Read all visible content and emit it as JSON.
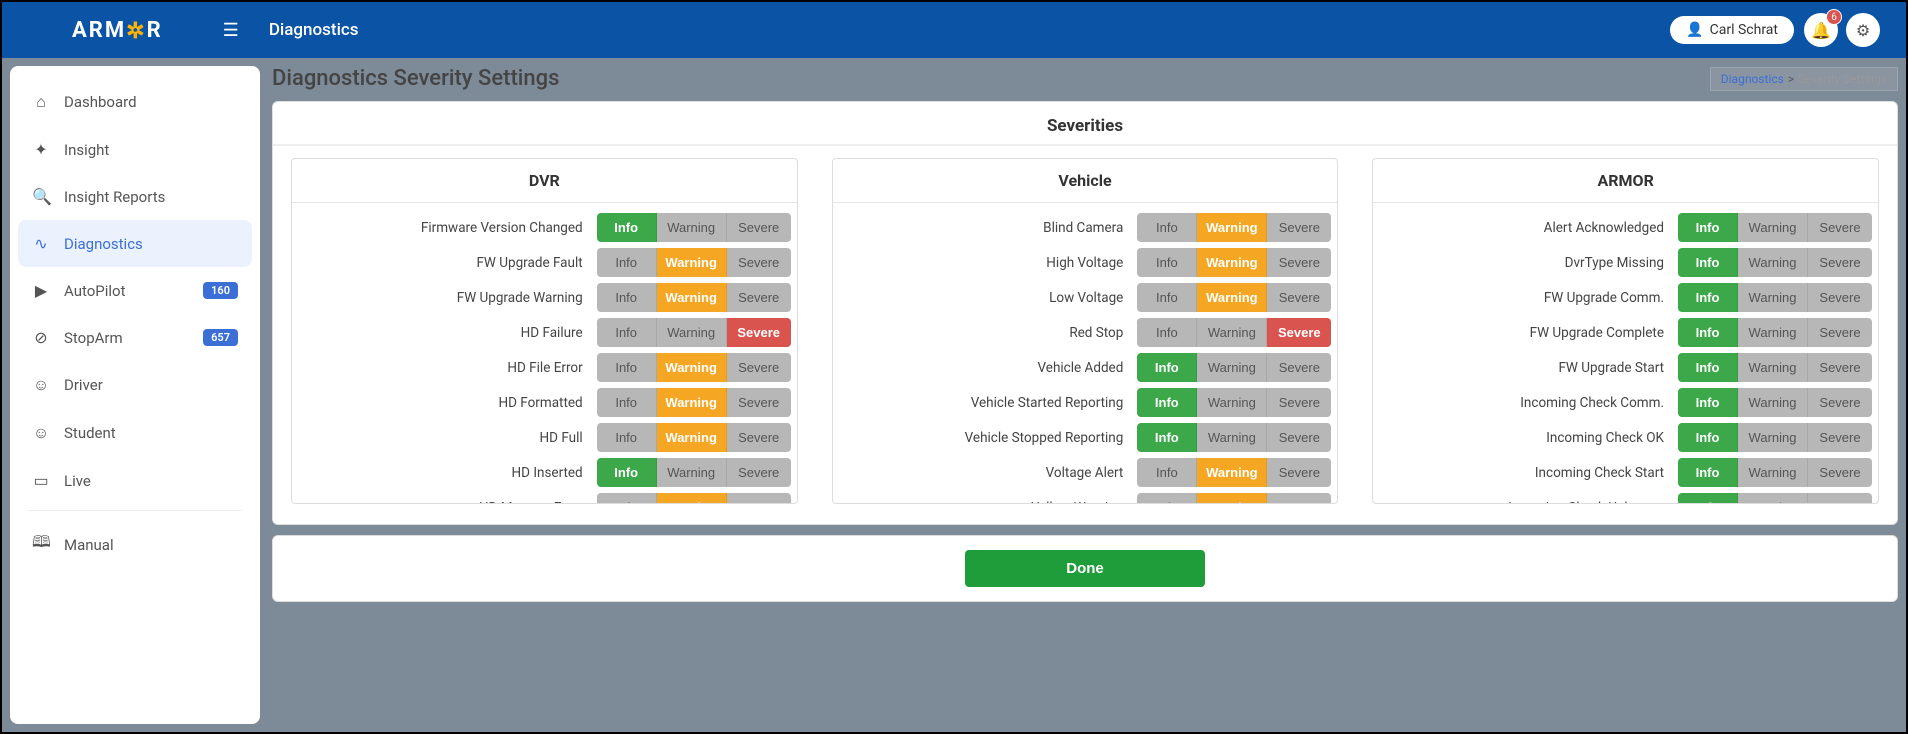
{
  "header": {
    "logo_prefix": "ARM",
    "logo_gear": "✲",
    "logo_suffix": "R",
    "title": "Diagnostics",
    "user_name": "Carl Schrat",
    "notification_count": "6"
  },
  "sidebar": {
    "items": [
      {
        "icon": "⌂",
        "label": "Dashboard",
        "badge": "",
        "active": false
      },
      {
        "icon": "✦",
        "label": "Insight",
        "badge": "",
        "active": false
      },
      {
        "icon": "🔍",
        "label": "Insight Reports",
        "badge": "",
        "active": false
      },
      {
        "icon": "∿",
        "label": "Diagnostics",
        "badge": "",
        "active": true
      },
      {
        "icon": "▶",
        "label": "AutoPilot",
        "badge": "160",
        "active": false
      },
      {
        "icon": "⊘",
        "label": "StopArm",
        "badge": "657",
        "active": false
      },
      {
        "icon": "☺",
        "label": "Driver",
        "badge": "",
        "active": false
      },
      {
        "icon": "☺",
        "label": "Student",
        "badge": "",
        "active": false
      },
      {
        "icon": "▭",
        "label": "Live",
        "badge": "",
        "active": false
      }
    ],
    "manual_label": "Manual",
    "manual_icon": "🕮"
  },
  "page": {
    "title": "Diagnostics Severity Settings",
    "breadcrumb_parent": "Diagnostics",
    "breadcrumb_sep": ">",
    "breadcrumb_current": "Severity Settings"
  },
  "severities": {
    "heading": "Severities",
    "labels": {
      "info": "Info",
      "warning": "Warning",
      "severe": "Severe"
    },
    "groups": [
      {
        "title": "DVR",
        "rows": [
          {
            "label": "Firmware Version Changed",
            "selected": "info"
          },
          {
            "label": "FW Upgrade Fault",
            "selected": "warning"
          },
          {
            "label": "FW Upgrade Warning",
            "selected": "warning"
          },
          {
            "label": "HD Failure",
            "selected": "severe"
          },
          {
            "label": "HD File Error",
            "selected": "warning"
          },
          {
            "label": "HD Formatted",
            "selected": "warning"
          },
          {
            "label": "HD Full",
            "selected": "warning"
          },
          {
            "label": "HD Inserted",
            "selected": "info"
          },
          {
            "label": "HD Memory Error",
            "selected": "warning"
          }
        ]
      },
      {
        "title": "Vehicle",
        "rows": [
          {
            "label": "Blind Camera",
            "selected": "warning"
          },
          {
            "label": "High Voltage",
            "selected": "warning"
          },
          {
            "label": "Low Voltage",
            "selected": "warning"
          },
          {
            "label": "Red Stop",
            "selected": "severe"
          },
          {
            "label": "Vehicle Added",
            "selected": "info"
          },
          {
            "label": "Vehicle Started Reporting",
            "selected": "info"
          },
          {
            "label": "Vehicle Stopped Reporting",
            "selected": "info"
          },
          {
            "label": "Voltage Alert",
            "selected": "warning"
          },
          {
            "label": "Yellow Warning",
            "selected": "warning"
          }
        ]
      },
      {
        "title": "ARMOR",
        "rows": [
          {
            "label": "Alert Acknowledged",
            "selected": "info"
          },
          {
            "label": "DvrType Missing",
            "selected": "info"
          },
          {
            "label": "FW Upgrade Comm.",
            "selected": "info"
          },
          {
            "label": "FW Upgrade Complete",
            "selected": "info"
          },
          {
            "label": "FW Upgrade Start",
            "selected": "info"
          },
          {
            "label": "Incoming Check Comm.",
            "selected": "info"
          },
          {
            "label": "Incoming Check OK",
            "selected": "info"
          },
          {
            "label": "Incoming Check Start",
            "selected": "info"
          },
          {
            "label": "Incoming Check Unknown",
            "selected": "info"
          }
        ]
      }
    ]
  },
  "footer": {
    "done_label": "Done"
  }
}
